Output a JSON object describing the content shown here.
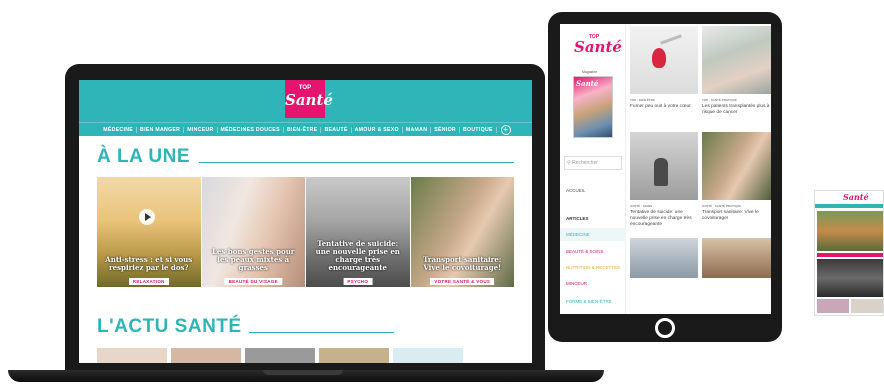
{
  "brand": {
    "top": "TOP",
    "name": "Santé",
    "pink": "#e5146e",
    "teal": "#2fb5b8"
  },
  "laptop": {
    "nav": [
      "MÉDECINE",
      "BIEN MANGER",
      "MINCEUR",
      "MÉDECINES DOUCES",
      "BIEN-ÊTRE",
      "BEAUTÉ",
      "AMOUR & SEXO",
      "MAMAN",
      "SÉNIOR",
      "BOUTIQUE"
    ],
    "section1": "À LA UNE",
    "section2": "L'ACTU SANTÉ",
    "cards": [
      {
        "caption": "Anti-stress : et si vous respiriez par le dos?",
        "tag": "RELAXATION",
        "video": true
      },
      {
        "caption": "Les bons gestes pour les peaux mixtes à grasses",
        "tag": "BEAUTÉ DU VISAGE"
      },
      {
        "caption": "Tentative de suicide: une nouvelle prise en charge très encourageante",
        "tag": "PSYCHO"
      },
      {
        "caption": "Transport sanitaire: Vive le covoiturage!",
        "tag": "VOTRE SANTÉ & VOUS"
      }
    ]
  },
  "tablet": {
    "search_placeholder": "Rechercher",
    "menu": [
      "ACCUEIL",
      "ARTICLES",
      "MÉDECINE",
      "BEAUTÉ & SOINS",
      "NUTRITION & RECETTES",
      "MINCEUR",
      "FORME & BIEN-ÊTRE"
    ],
    "magazine_label": "Magazine",
    "articles": [
      {
        "meta": "TOP · BIEN-ÊTRE",
        "text": "Fumer peu nuit à votre cœur"
      },
      {
        "meta": "TOP · SANTÉ PRATIQUE",
        "text": "Les patients transplantés plus à risque de cancer"
      },
      {
        "meta": "SANTÉ · SOINS",
        "text": "Tentative de suicide: une nouvelle prise en charge très encourageante"
      },
      {
        "meta": "SANTÉ · SANTÉ PRATIQUE",
        "text": "Transport sanitaire: Vive le covoiturage!"
      }
    ]
  }
}
